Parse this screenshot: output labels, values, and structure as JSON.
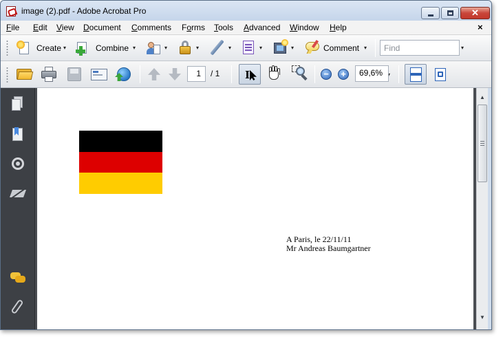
{
  "window": {
    "title": "image (2).pdf - Adobe Acrobat Pro"
  },
  "window_controls": {
    "minimize": "–",
    "maximize": "□",
    "close": "✕"
  },
  "menubar": {
    "items": [
      {
        "label": "File",
        "ul": "F",
        "rest": "ile"
      },
      {
        "label": "Edit",
        "ul": "E",
        "rest": "dit"
      },
      {
        "label": "View",
        "ul": "V",
        "rest": "iew"
      },
      {
        "label": "Document",
        "ul": "D",
        "rest": "ocument"
      },
      {
        "label": "Comments",
        "ul": "C",
        "rest": "omments"
      },
      {
        "label": "Forms",
        "pre": "F",
        "ul": "o",
        "rest": "rms"
      },
      {
        "label": "Tools",
        "ul": "T",
        "rest": "ools"
      },
      {
        "label": "Advanced",
        "ul": "A",
        "rest": "dvanced"
      },
      {
        "label": "Window",
        "ul": "W",
        "rest": "indow"
      },
      {
        "label": "Help",
        "ul": "H",
        "rest": "elp"
      }
    ],
    "close_glyph": "×"
  },
  "toolbar_tasks": {
    "create_label": "Create",
    "combine_label": "Combine",
    "comment_label": "Comment",
    "dropdown_glyph": "▾",
    "find_placeholder": "Find"
  },
  "toolbar_nav": {
    "current_page": "1",
    "page_total": "/ 1",
    "zoom_out_glyph": "−",
    "zoom_in_glyph": "+",
    "zoom_level": "69,6%",
    "dropdown_glyph": "▾"
  },
  "icons": {
    "nav_panel": [
      "pages-icon",
      "bookmarks-icon",
      "target-icon",
      "signatures-icon",
      "comments-icon",
      "attachments-icon"
    ],
    "toolbar": [
      "create-icon",
      "combine-icon",
      "collaborate-icon",
      "secure-lock-icon",
      "sign-pen-icon",
      "forms-icon",
      "multimedia-icon",
      "comment-icon",
      "open-folder-icon",
      "print-icon",
      "save-icon",
      "email-icon",
      "web-globe-icon",
      "previous-page-icon",
      "next-page-icon",
      "select-tool-icon",
      "hand-tool-icon",
      "marquee-zoom-icon",
      "fit-width-icon",
      "fit-page-icon"
    ]
  },
  "document": {
    "flag_colors": [
      "#000000",
      "#dd0000",
      "#ffcc00"
    ],
    "address_line1": "A Paris, le 22/11/11",
    "address_line2": "Mr Andreas Baumgartner"
  },
  "scrollbar": {
    "up_glyph": "▲",
    "down_glyph": "▼"
  }
}
